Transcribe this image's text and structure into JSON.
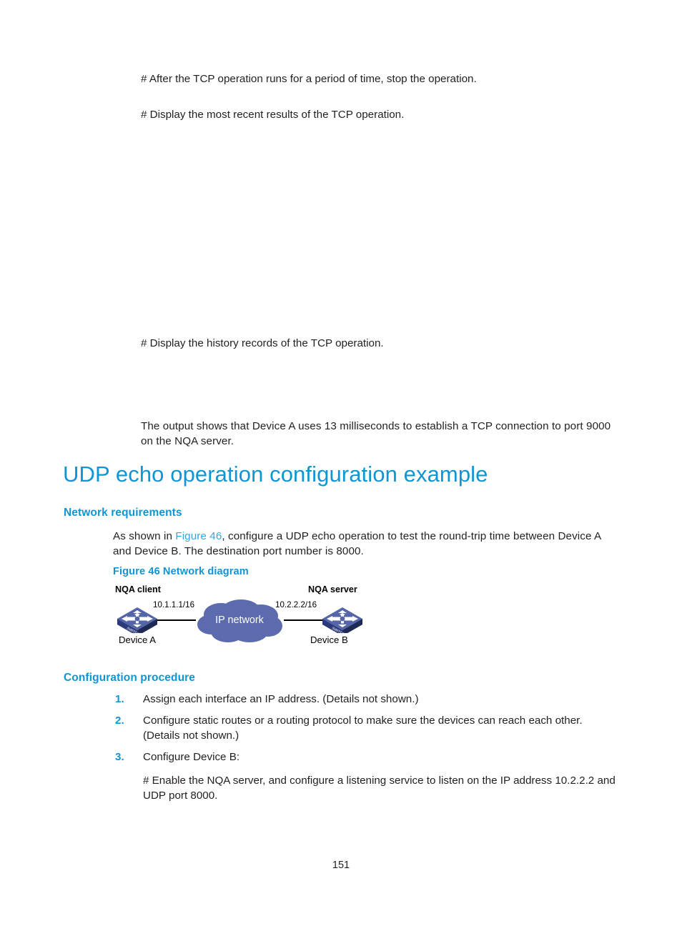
{
  "document": {
    "page_number": "151"
  },
  "blocks": {
    "cmd_stop": "# After the TCP operation runs for a period of time, stop the operation.",
    "cmd_display_recent": "# Display the most recent results of the TCP operation.",
    "cmd_display_history": "# Display the history records of the TCP operation.",
    "output_note": "The output shows that Device A uses 13 milliseconds to establish a TCP connection to port 9000 on the NQA server."
  },
  "section": {
    "title": "UDP echo operation configuration example",
    "network_requirements_heading": "Network requirements",
    "network_requirements_text_before": "As shown in ",
    "network_requirements_link": "Figure 46",
    "network_requirements_text_after": ", configure a UDP echo operation to test the round-trip time between Device A and Device B. The destination port number is 8000.",
    "figure_caption": "Figure 46 Network diagram",
    "configuration_procedure_heading": "Configuration procedure"
  },
  "procedure": {
    "items": [
      {
        "num": "1.",
        "text": "Assign each interface an IP address. (Details not shown.)"
      },
      {
        "num": "2.",
        "text": "Configure static routes or a routing protocol to make sure the devices can reach each other. (Details not shown.)"
      },
      {
        "num": "3.",
        "text": "Configure Device B:"
      }
    ],
    "step3_command": "# Enable the NQA server, and configure a listening service to listen on the IP address 10.2.2.2 and UDP port 8000."
  },
  "diagram": {
    "client_role": "NQA client",
    "server_role": "NQA server",
    "client_device": "Device A",
    "server_device": "Device B",
    "client_ip": "10.1.1.1/16",
    "server_ip": "10.2.2.2/16",
    "cloud_label": "IP network",
    "switch_face_label": "SWITCH"
  },
  "colors": {
    "heading_blue": "#0e96d4",
    "link_blue": "#33a8e0",
    "cloud_fill": "#5b6bad",
    "switch_body": "#2a3a7a",
    "switch_top": "#5566a8",
    "text": "#231f20"
  }
}
